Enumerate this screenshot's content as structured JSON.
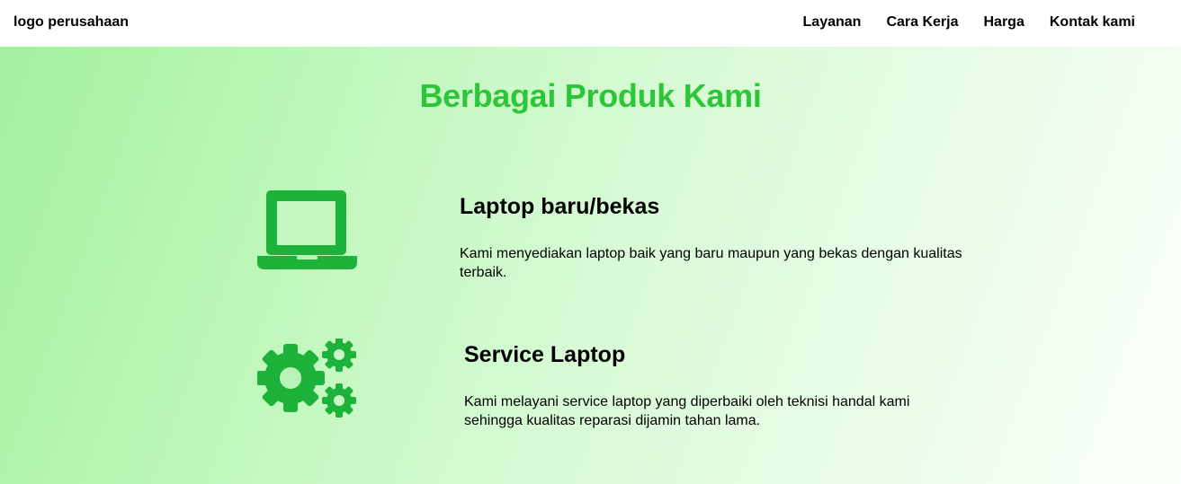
{
  "header": {
    "logo_alt": "logo perusahaan",
    "nav": [
      {
        "label": "Layanan"
      },
      {
        "label": "Cara Kerja"
      },
      {
        "label": "Harga"
      },
      {
        "label": "Kontak kami"
      }
    ]
  },
  "products": {
    "title": "Berbagai Produk Kami",
    "items": [
      {
        "icon": "laptop-icon",
        "title": "Laptop baru/bekas",
        "description": "Kami menyediakan laptop baik yang baru maupun yang bekas dengan kualitas terbaik."
      },
      {
        "icon": "gears-icon",
        "title": "Service Laptop",
        "description": "Kami melayani service laptop yang diperbaiki oleh teknisi handal kami sehingga kualitas reparasi dijamin tahan lama."
      }
    ]
  },
  "colors": {
    "accent": "#2ec639",
    "icon": "#1db33a",
    "hero_start": "#a3f09f",
    "hero_end": "#fbfffb"
  }
}
